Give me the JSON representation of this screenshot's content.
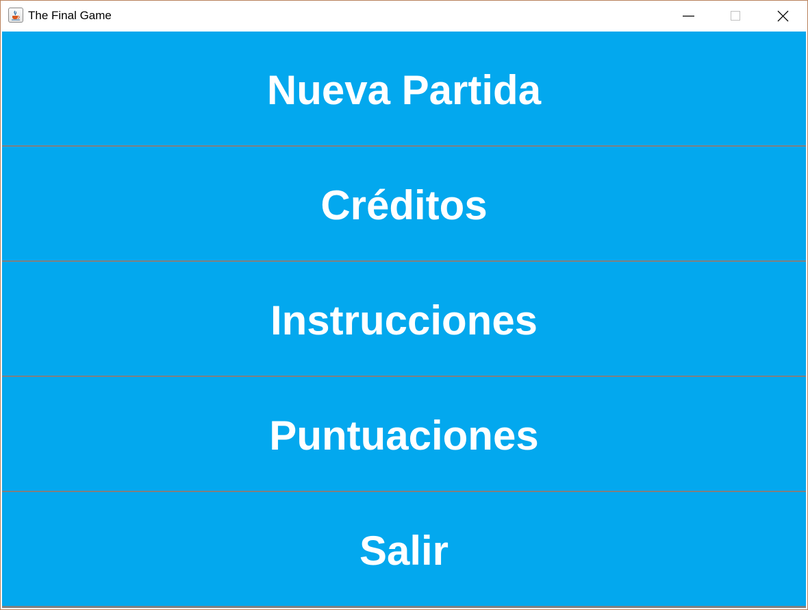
{
  "window": {
    "title": "The Final Game",
    "icon": "java-cup-icon",
    "controls": [
      "minimize-icon",
      "maximize-icon",
      "close-icon"
    ]
  },
  "colors": {
    "button_bg": "#03a8ee",
    "button_text": "#ffffff",
    "separator": "#808080"
  },
  "menu": {
    "items": [
      {
        "label": "Nueva Partida"
      },
      {
        "label": "Créditos"
      },
      {
        "label": "Instrucciones"
      },
      {
        "label": "Puntuaciones"
      },
      {
        "label": "Salir"
      }
    ]
  }
}
